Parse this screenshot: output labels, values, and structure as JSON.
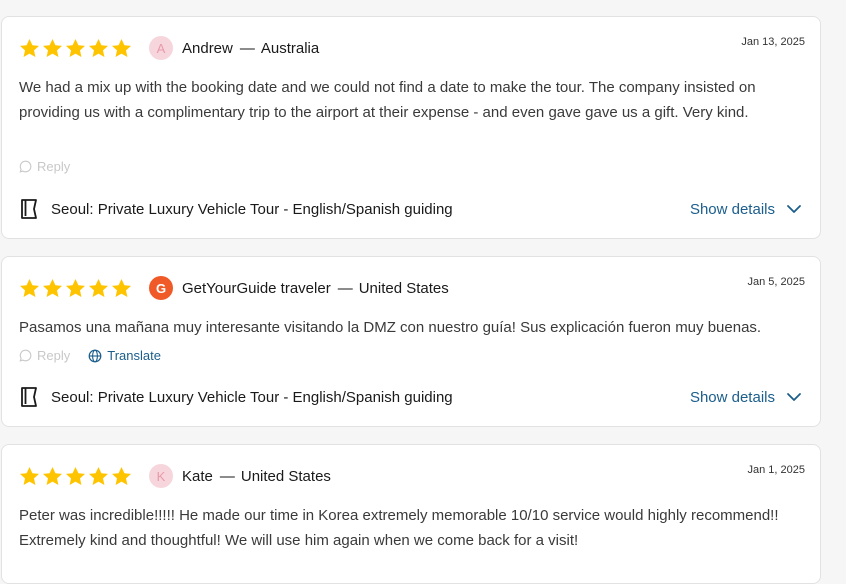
{
  "colors": {
    "star": "#ffc400",
    "link": "#1b5e8c",
    "g_avatar": "#f05a28",
    "muted": "#c8c8c8"
  },
  "reviews": [
    {
      "rating": 5,
      "avatar": "A",
      "name": "Andrew",
      "country": "Australia",
      "date": "Jan 13, 2025",
      "text": "We had a mix up with the booking date and we could not find a date to make the tour. The company insisted on providing us with a complimentary trip to the airport at their expense - and even gave gave us a gift. Very kind.",
      "reply_label": "Reply",
      "activity": "Seoul: Private Luxury Vehicle Tour - English/Spanish guiding",
      "show_details": "Show details"
    },
    {
      "rating": 5,
      "avatar": "G",
      "name": "GetYourGuide traveler",
      "country": "United States",
      "date": "Jan 5, 2025",
      "text": "Pasamos una mañana muy interesante visitando la DMZ con nuestro guía! Sus explicación fueron muy buenas.",
      "reply_label": "Reply",
      "translate_label": "Translate",
      "activity": "Seoul: Private Luxury Vehicle Tour - English/Spanish guiding",
      "show_details": "Show details"
    },
    {
      "rating": 5,
      "avatar": "K",
      "name": "Kate",
      "country": "United States",
      "date": "Jan 1, 2025",
      "text": "Peter was incredible!!!!! He made our time in Korea extremely memorable 10/10 service would highly recommend!! Extremely kind and thoughtful! We will use him again when we come back for a visit!"
    }
  ]
}
